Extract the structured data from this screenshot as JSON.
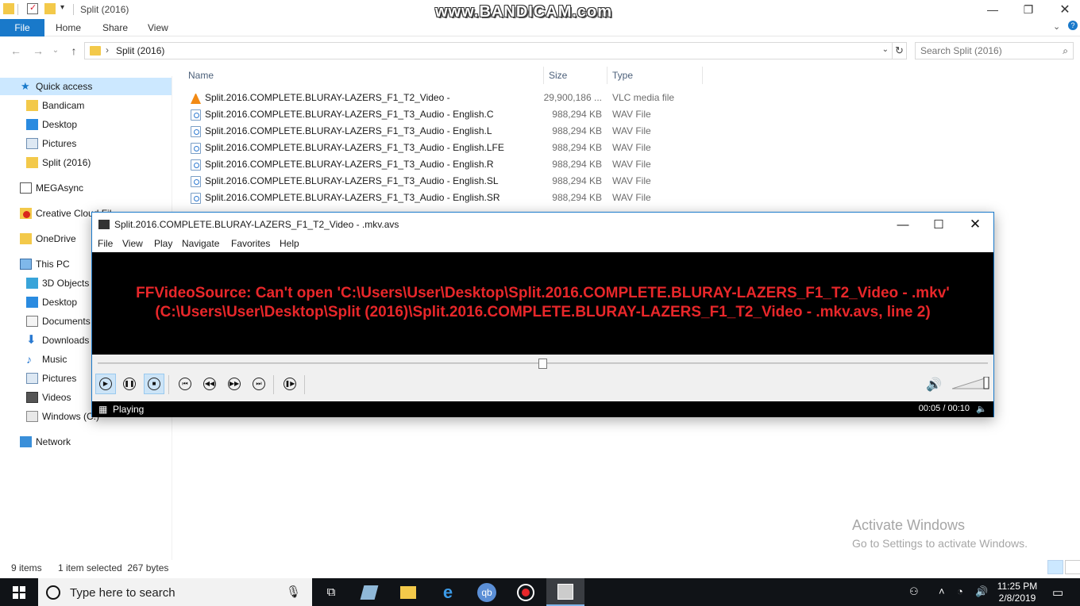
{
  "explorer": {
    "title": "Split (2016)",
    "watermark": "www.BANDICAM.com",
    "ribbon_tabs": [
      "File",
      "Home",
      "Share",
      "View"
    ],
    "address_path": "Split (2016)",
    "search_placeholder": "Search Split (2016)",
    "columns": {
      "name": "Name",
      "size": "Size",
      "type": "Type"
    },
    "nav": [
      {
        "label": "Quick access",
        "icon": "star-icon",
        "selected": true
      },
      {
        "label": "Bandicam",
        "icon": "folder-icon"
      },
      {
        "label": "Desktop",
        "icon": "desktop-icon"
      },
      {
        "label": "Pictures",
        "icon": "pictures-icon"
      },
      {
        "label": "Split (2016)",
        "icon": "folder-icon"
      },
      {
        "label": "MEGAsync",
        "icon": "mega-icon"
      },
      {
        "label": "Creative Cloud Fil",
        "icon": "creative-cloud-icon"
      },
      {
        "label": "OneDrive",
        "icon": "folder-icon"
      },
      {
        "label": "This PC",
        "icon": "pc-icon"
      },
      {
        "label": "3D Objects",
        "icon": "cube-icon"
      },
      {
        "label": "Desktop",
        "icon": "desktop-icon"
      },
      {
        "label": "Documents",
        "icon": "documents-icon"
      },
      {
        "label": "Downloads",
        "icon": "download-icon"
      },
      {
        "label": "Music",
        "icon": "music-icon"
      },
      {
        "label": "Pictures",
        "icon": "pictures-icon"
      },
      {
        "label": "Videos",
        "icon": "videos-icon"
      },
      {
        "label": "Windows (C:)",
        "icon": "drive-icon"
      },
      {
        "label": "Network",
        "icon": "network-icon"
      }
    ],
    "files": [
      {
        "name": "Split.2016.COMPLETE.BLURAY-LAZERS_F1_T2_Video -",
        "size": "29,900,186 ...",
        "type": "VLC media file",
        "icon": "vlc-icon"
      },
      {
        "name": "Split.2016.COMPLETE.BLURAY-LAZERS_F1_T3_Audio - English.C",
        "size": "988,294 KB",
        "type": "WAV File",
        "icon": "wav-icon"
      },
      {
        "name": "Split.2016.COMPLETE.BLURAY-LAZERS_F1_T3_Audio - English.L",
        "size": "988,294 KB",
        "type": "WAV File",
        "icon": "wav-icon"
      },
      {
        "name": "Split.2016.COMPLETE.BLURAY-LAZERS_F1_T3_Audio - English.LFE",
        "size": "988,294 KB",
        "type": "WAV File",
        "icon": "wav-icon"
      },
      {
        "name": "Split.2016.COMPLETE.BLURAY-LAZERS_F1_T3_Audio - English.R",
        "size": "988,294 KB",
        "type": "WAV File",
        "icon": "wav-icon"
      },
      {
        "name": "Split.2016.COMPLETE.BLURAY-LAZERS_F1_T3_Audio - English.SL",
        "size": "988,294 KB",
        "type": "WAV File",
        "icon": "wav-icon"
      },
      {
        "name": "Split.2016.COMPLETE.BLURAY-LAZERS_F1_T3_Audio - English.SR",
        "size": "988,294 KB",
        "type": "WAV File",
        "icon": "wav-icon"
      }
    ],
    "status": {
      "items": "9 items",
      "selected": "1 item selected  267 bytes"
    }
  },
  "activate": {
    "line1": "Activate Windows",
    "line2": "Go to Settings to activate Windows."
  },
  "player": {
    "title": "Split.2016.COMPLETE.BLURAY-LAZERS_F1_T2_Video - .mkv.avs",
    "menu": [
      "File",
      "View",
      "Play",
      "Navigate",
      "Favorites",
      "Help"
    ],
    "error_line1": "FFVideoSource: Can't open 'C:\\Users\\User\\Desktop\\Split.2016.COMPLETE.BLURAY-LAZERS_F1_T2_Video - .mkv'",
    "error_line2": "(C:\\Users\\User\\Desktop\\Split (2016)\\Split.2016.COMPLETE.BLURAY-LAZERS_F1_T2_Video - .mkv.avs, line 2)",
    "state": "Playing",
    "time": "00:05 / 00:10",
    "seek_fraction": 0.5,
    "volume_fraction": 1.0
  },
  "taskbar": {
    "search_placeholder": "Type here to search",
    "clock_time": "11:25 PM",
    "clock_date": "2/8/2019"
  }
}
